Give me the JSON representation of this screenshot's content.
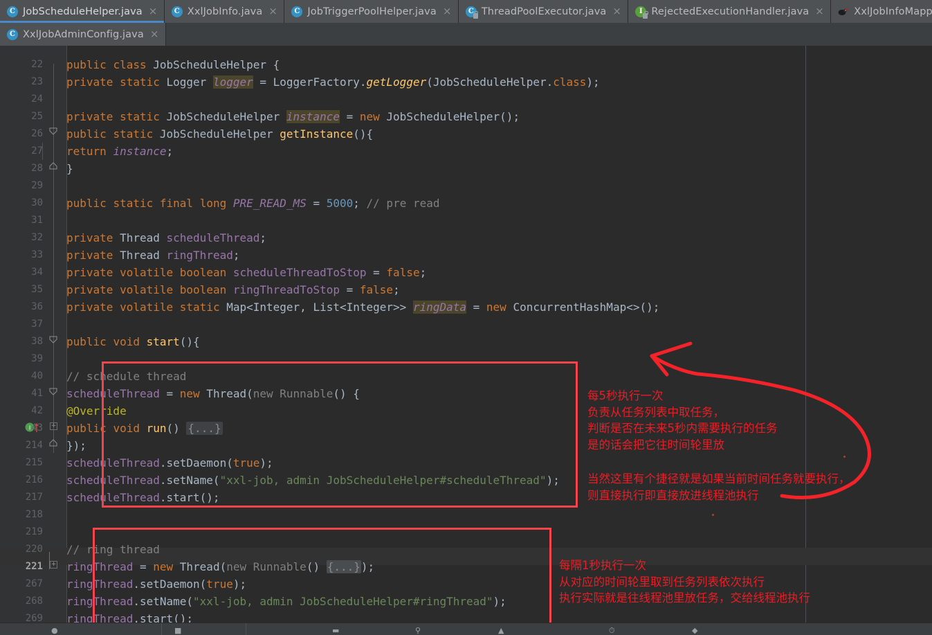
{
  "window": {
    "theme": "darcula",
    "accent": "#4a88c7",
    "annotation_color": "#ed1c24",
    "background": "#2b2b2b",
    "gutter_background": "#313335"
  },
  "tabs": {
    "row1": [
      {
        "label": "JobScheduleHelper.java",
        "icon": "java-class-icon",
        "active": true,
        "close": "×"
      },
      {
        "label": "XxlJobInfo.java",
        "icon": "java-class-icon",
        "active": false,
        "close": "×"
      },
      {
        "label": "JobTriggerPoolHelper.java",
        "icon": "java-class-icon",
        "active": false,
        "close": "×"
      },
      {
        "label": "ThreadPoolExecutor.java",
        "icon": "java-class-readonly-icon",
        "active": false,
        "close": "×"
      },
      {
        "label": "RejectedExecutionHandler.java",
        "icon": "java-interface-readonly-icon",
        "active": false,
        "close": "×"
      },
      {
        "label": "XxlJobInfoMapp",
        "icon": "mybatis-mapper-icon",
        "active": false,
        "close": ""
      }
    ],
    "row2": [
      {
        "label": "XxlJobAdminConfig.java",
        "icon": "java-class-icon",
        "active": false,
        "close": "×"
      }
    ]
  },
  "editor": {
    "current_line": "221",
    "lines": [
      {
        "n": "22",
        "indent": 0
      },
      {
        "n": "23",
        "indent": 1
      },
      {
        "n": "24",
        "indent": 0
      },
      {
        "n": "25",
        "indent": 1
      },
      {
        "n": "26",
        "indent": 1
      },
      {
        "n": "27",
        "indent": 2
      },
      {
        "n": "28",
        "indent": 1
      },
      {
        "n": "29",
        "indent": 0
      },
      {
        "n": "30",
        "indent": 1
      },
      {
        "n": "31",
        "indent": 0
      },
      {
        "n": "32",
        "indent": 1
      },
      {
        "n": "33",
        "indent": 1
      },
      {
        "n": "34",
        "indent": 1
      },
      {
        "n": "35",
        "indent": 1
      },
      {
        "n": "36",
        "indent": 1
      },
      {
        "n": "37",
        "indent": 0
      },
      {
        "n": "38",
        "indent": 1
      },
      {
        "n": "39",
        "indent": 0
      },
      {
        "n": "40",
        "indent": 2
      },
      {
        "n": "41",
        "indent": 2
      },
      {
        "n": "42",
        "indent": 3
      },
      {
        "n": "43",
        "indent": 3
      },
      {
        "n": "214",
        "indent": 2
      },
      {
        "n": "215",
        "indent": 2
      },
      {
        "n": "216",
        "indent": 2
      },
      {
        "n": "217",
        "indent": 2
      },
      {
        "n": "218",
        "indent": 0
      },
      {
        "n": "219",
        "indent": 0
      },
      {
        "n": "220",
        "indent": 2
      },
      {
        "n": "221",
        "indent": 2
      },
      {
        "n": "267",
        "indent": 2
      },
      {
        "n": "268",
        "indent": 2
      },
      {
        "n": "269",
        "indent": 2
      }
    ],
    "source_text": [
      "public class JobScheduleHelper {",
      "    private static Logger logger = LoggerFactory.getLogger(JobScheduleHelper.class);",
      "",
      "    private static JobScheduleHelper instance = new JobScheduleHelper();",
      "    public static JobScheduleHelper getInstance(){",
      "        return instance;",
      "    }",
      "",
      "    public static final long PRE_READ_MS = 5000;    // pre read",
      "",
      "    private Thread scheduleThread;",
      "    private Thread ringThread;",
      "    private volatile boolean scheduleThreadToStop = false;",
      "    private volatile boolean ringThreadToStop = false;",
      "    private volatile static Map<Integer, List<Integer>> ringData = new ConcurrentHashMap<>();",
      "",
      "    public void start(){",
      "",
      "        // schedule thread",
      "        scheduleThread = new Thread(new Runnable() {",
      "            @Override",
      "            public void run() {...}",
      "        });",
      "        scheduleThread.setDaemon(true);",
      "        scheduleThread.setName(\"xxl-job, admin JobScheduleHelper#scheduleThread\");",
      "        scheduleThread.start();",
      "",
      "",
      "        // ring thread",
      "        ringThread = new Thread(new Runnable() {...});",
      "        ringThread.setDaemon(true);",
      "        ringThread.setName(\"xxl-job, admin JobScheduleHelper#ringThread\");",
      "        ringThread.start();"
    ]
  },
  "annotations": {
    "note_schedule": {
      "lines": [
        "每5秒执行一次",
        "负责从任务列表中取任务，",
        "判断是否在未来5秒内需要执行的任务",
        "是的话会把它往时间轮里放"
      ]
    },
    "note_shortcut": {
      "lines": [
        "当然这里有个捷径就是如果当前时间任务就要执行，",
        "则直接执行即直接放进线程池执行"
      ]
    },
    "note_ring": {
      "lines": [
        "每隔1秒执行一次",
        "从对应的时间轮里取到任务列表依次执行",
        "执行实际就是往线程池里放任务，交给线程池执行"
      ]
    }
  }
}
